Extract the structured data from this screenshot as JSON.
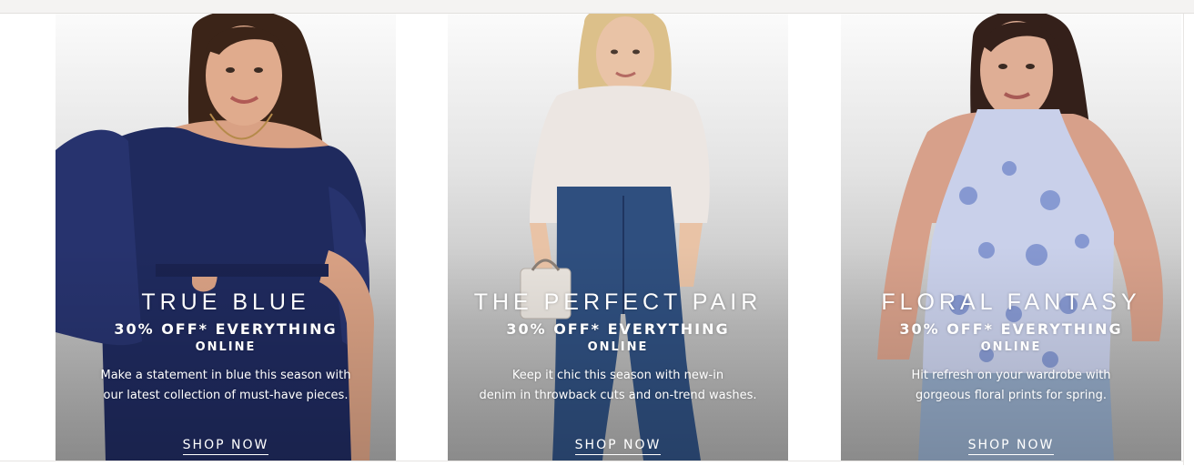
{
  "cards": [
    {
      "title": "TRUE BLUE",
      "offer": "30% OFF* EVERYTHING",
      "channel": "ONLINE",
      "description_line1": "Make a statement in blue this season with",
      "description_line2": "our latest collection of must-have pieces.",
      "cta": "SHOP NOW",
      "garment_color": "#1f2a5e"
    },
    {
      "title": "THE PERFECT PAIR",
      "offer": "30% OFF* EVERYTHING",
      "channel": "ONLINE",
      "description_line1": "Keep it chic this season with new-in",
      "description_line2": "denim in throwback cuts and on-trend washes.",
      "cta": "SHOP NOW",
      "garment_color": "#2f4f7f"
    },
    {
      "title": "FLORAL FANTASY",
      "offer": "30% OFF* EVERYTHING",
      "channel": "ONLINE",
      "description_line1": "Hit refresh on your wardrobe with",
      "description_line2": "gorgeous floral prints for spring.",
      "cta": "SHOP NOW",
      "garment_color": "#8fa3d6"
    }
  ]
}
